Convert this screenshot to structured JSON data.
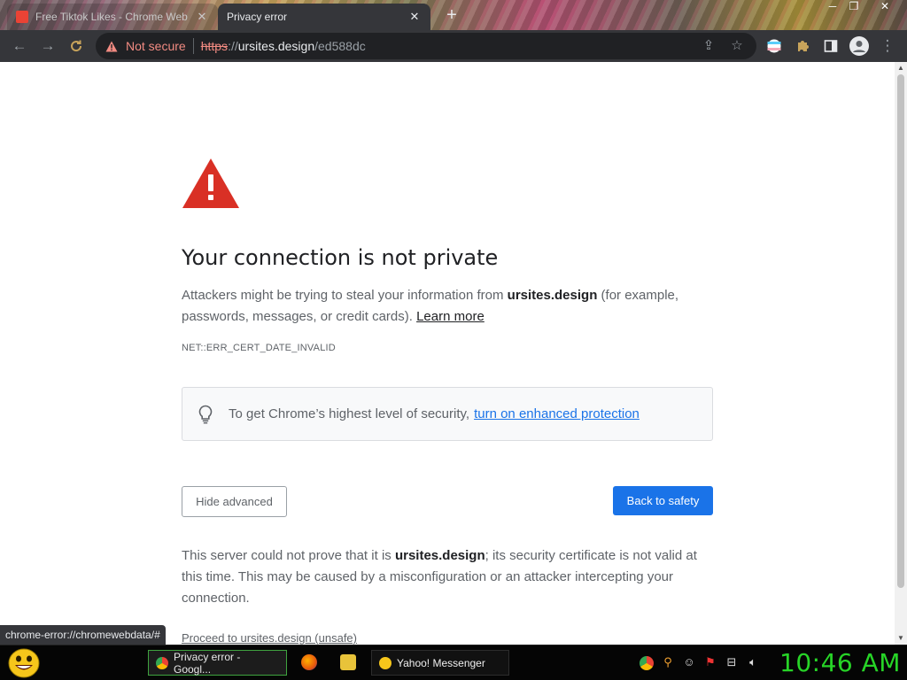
{
  "browser": {
    "tabs": [
      {
        "title": "Free Tiktok Likes - Chrome Web",
        "active": false
      },
      {
        "title": "Privacy error",
        "active": true
      }
    ],
    "new_tab_symbol": "+",
    "security_label": "Not secure",
    "url": {
      "scheme": "https",
      "separator": "://",
      "host": "ursites.design",
      "path": "/ed588dc"
    }
  },
  "page": {
    "heading": "Your connection is not private",
    "intro_prefix": "Attackers might be trying to steal your information from ",
    "intro_host": "ursites.design",
    "intro_suffix": " (for example, passwords, messages, or credit cards). ",
    "learn_more": "Learn more",
    "error_code": "NET::ERR_CERT_DATE_INVALID",
    "tip_text": "To get Chrome’s highest level of security,",
    "tip_link": "turn on enhanced protection",
    "hide_advanced": "Hide advanced",
    "back_to_safety": "Back to safety",
    "detail_prefix": "This server could not prove that it is ",
    "detail_host": "ursites.design",
    "detail_suffix": "; its security certificate is not valid at this time. This may be caused by a misconfiguration or an attacker intercepting your connection.",
    "proceed": "Proceed to ursites.design (unsafe)",
    "status_url": "chrome-error://chromewebdata/#"
  },
  "taskbar": {
    "tasks": [
      {
        "label": "Privacy error - Googl...",
        "icon": "chrome-icon"
      },
      {
        "label": "Yahoo! Messenger",
        "icon": "yahoo-messenger-icon"
      }
    ],
    "clock": "10:46 AM"
  },
  "colors": {
    "link_blue": "#1a73e8",
    "warning_red": "#d93025",
    "not_secure_red": "#f28b82",
    "clock_green": "#27d427"
  }
}
